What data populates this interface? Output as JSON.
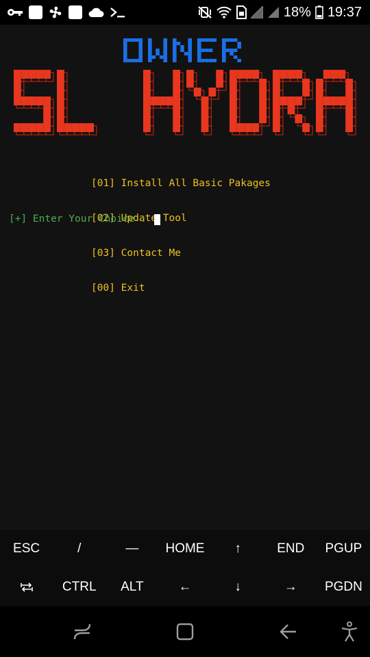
{
  "status_bar": {
    "battery_percent": "18%",
    "time": "19:37",
    "left_icons": [
      "key-icon",
      "notification-square-icon",
      "fan-icon",
      "notification-square-icon",
      "cloud-icon",
      "terminal-icon"
    ],
    "right_icons": [
      "mute-vibrate-icon",
      "wifi-icon",
      "sim-icon",
      "signal-icon",
      "signal-icon",
      "battery-icon"
    ]
  },
  "banner": {
    "line1": "OWNER",
    "line2": "SL HYDRA",
    "line1_color": "#1a6fe6",
    "line2_color": "#e8371e"
  },
  "menu": {
    "items": [
      "[01] Install All Basic Pakages",
      "[02] Update Tool",
      "[03] Contact Me",
      "[00] Exit"
    ],
    "color": "#f0c020"
  },
  "prompt": {
    "text": "[+] Enter Your Choice : ",
    "color": "#4caf50"
  },
  "extra_keys": {
    "row1": [
      "ESC",
      "/",
      "—",
      "HOME",
      "↑",
      "END",
      "PGUP"
    ],
    "row2": [
      "⭾",
      "CTRL",
      "ALT",
      "←",
      "↓",
      "→",
      "PGDN"
    ]
  },
  "nav_bar": {
    "icons": [
      "recent-apps-icon",
      "home-icon",
      "back-icon",
      "accessibility-icon"
    ]
  }
}
